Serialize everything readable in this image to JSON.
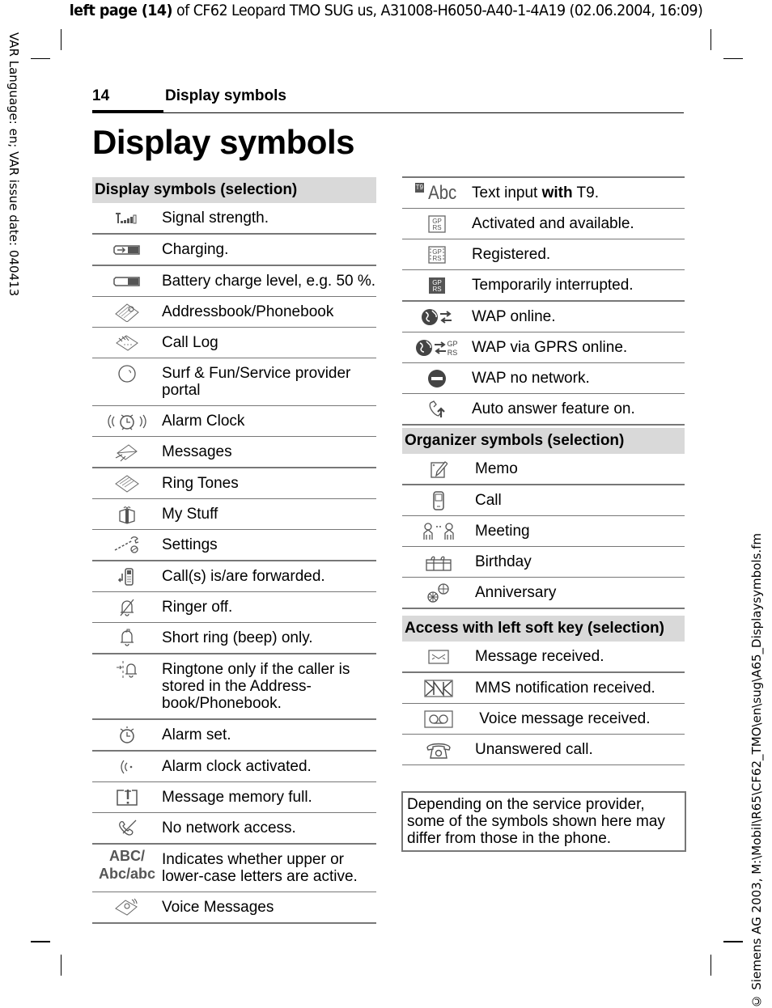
{
  "print_header": {
    "bold": "left page (14)",
    "rest": " of CF62 Leopard TMO SUG us, A31008-H6050-A40-1-4A19 (02.06.2004, 16:09)"
  },
  "margin_left": "VAR Language: en; VAR issue date: 040413",
  "margin_right": "© Siemens AG 2003, M:\\Mobil\\R65\\CF62_TMO\\en\\sug\\A65_Displaysymbols.fm",
  "running_head": {
    "page_number": "14",
    "title": "Display symbols"
  },
  "page_title": "Display symbols",
  "display_symbols": {
    "header": "Display symbols (selection)",
    "rows": [
      {
        "icon": "signal-strength-icon",
        "text": "Signal strength."
      },
      {
        "icon": "charging-icon",
        "text": "Charging."
      },
      {
        "icon": "battery-level-icon",
        "text": "Battery charge level, e.g. 50 %."
      },
      {
        "icon": "addressbook-icon",
        "text": "Addressbook/Phonebook"
      },
      {
        "icon": "call-log-icon",
        "text": "Call Log"
      },
      {
        "icon": "globe-icon",
        "text": "Surf & Fun/Service provider portal"
      },
      {
        "icon": "alarm-clock-ringing-icon",
        "text": "Alarm Clock"
      },
      {
        "icon": "messages-icon",
        "text": "Messages"
      },
      {
        "icon": "ring-tones-icon",
        "text": "Ring Tones"
      },
      {
        "icon": "gift-box-icon",
        "text": "My Stuff"
      },
      {
        "icon": "wrench-icon",
        "text": "Settings"
      },
      {
        "icon": "call-forward-icon",
        "text": "Call(s) is/are forwarded."
      },
      {
        "icon": "ringer-off-icon",
        "text": "Ringer off."
      },
      {
        "icon": "short-ring-icon",
        "text": "Short ring (beep) only."
      },
      {
        "icon": "caller-ringtone-icon",
        "text": "Ringtone only if the caller is stored in the Address-book/Phonebook."
      },
      {
        "icon": "alarm-set-icon",
        "text": "Alarm set."
      },
      {
        "icon": "alarm-activated-icon",
        "text": "Alarm clock activated."
      },
      {
        "icon": "memory-full-icon",
        "text": "Message memory full."
      },
      {
        "icon": "no-network-icon",
        "text": "No network access."
      },
      {
        "icon": "text-case-icon",
        "icon_text": [
          "ABC/",
          "Abc/abc"
        ],
        "text": "Indicates whether upper or lower-case letters are active."
      },
      {
        "icon": "voice-messages-icon",
        "text": "Voice Messages"
      }
    ]
  },
  "right_symbols": {
    "rows": [
      {
        "icon": "t9-icon",
        "icon_badge": "T9",
        "icon_text": "Abc",
        "text_pre": "Text input ",
        "text_bold": "with",
        "text_post": " T9."
      },
      {
        "icon": "gprs-available-icon",
        "text": "Activated and available."
      },
      {
        "icon": "gprs-registered-icon",
        "text": "Registered."
      },
      {
        "icon": "gprs-interrupted-icon",
        "text": "Temporarily interrupted."
      },
      {
        "icon": "wap-online-icon",
        "text": "WAP online."
      },
      {
        "icon": "wap-gprs-online-icon",
        "text": "WAP via GPRS online."
      },
      {
        "icon": "wap-no-network-icon",
        "text": "WAP no network."
      },
      {
        "icon": "auto-answer-icon",
        "text": "Auto answer feature on."
      }
    ]
  },
  "organizer_symbols": {
    "header": "Organizer symbols (selection)",
    "rows": [
      {
        "icon": "memo-icon",
        "text": "Memo"
      },
      {
        "icon": "call-phone-icon",
        "text": "Call"
      },
      {
        "icon": "meeting-icon",
        "text": "Meeting"
      },
      {
        "icon": "birthday-icon",
        "text": "Birthday"
      },
      {
        "icon": "anniversary-icon",
        "text": "Anniversary"
      }
    ]
  },
  "left_soft_key": {
    "header": "Access with left soft key (selection)",
    "rows": [
      {
        "icon": "message-received-icon",
        "text": "Message received."
      },
      {
        "icon": "mms-notification-icon",
        "text": "MMS notification received."
      },
      {
        "icon": "voice-message-icon",
        "text": " Voice message received."
      },
      {
        "icon": "unanswered-call-icon",
        "text": "Unanswered call."
      }
    ]
  },
  "note": "Depending on the service provider, some of the symbols shown here may differ from those in the phone."
}
